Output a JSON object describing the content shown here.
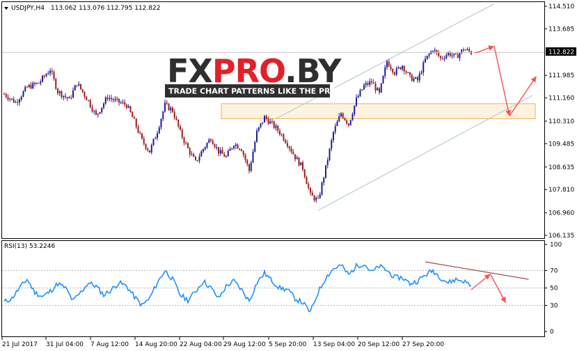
{
  "header": {
    "symbol": "USDJPY,H4",
    "ohlc": "113.062 113.076 112.795 112.822",
    "rsi_label": "RSI(13) 53.2246"
  },
  "logo": {
    "text": "FXPRO.BY",
    "tagline": "TRADE CHART PATTERNS LIKE THE PROS"
  },
  "price_axis": {
    "ticks": [
      "114.510",
      "113.685",
      "112.822",
      "111.985",
      "111.160",
      "110.310",
      "109.485",
      "108.635",
      "107.810",
      "106.960",
      "106.135"
    ],
    "current_price": "112.822"
  },
  "rsi_axis": {
    "ticks": [
      "100",
      "70",
      "50",
      "30",
      "0"
    ]
  },
  "time_axis": {
    "ticks": [
      "21 Jul 2017",
      "31 Jul 04:00",
      "7 Aug 12:00",
      "14 Aug 20:00",
      "22 Aug 04:00",
      "29 Aug 12:00",
      "5 Sep 20:00",
      "13 Sep 04:00",
      "20 Sep 12:00",
      "27 Sep 20:00"
    ]
  },
  "colors": {
    "bull_candle": "#1a1aa0",
    "bear_candle": "#9b1a1a",
    "rsi_line": "#1e90ff",
    "channel": "#a9c2d4",
    "zone_fill": "#fde9c6",
    "zone_border": "#f1b24a",
    "forecast_arrow": "#ff4d4d",
    "rsi_trend": "#a05050",
    "logo_red": "#e3202a",
    "logo_dark": "#2f2f2f"
  },
  "chart_data": [
    {
      "type": "candlestick",
      "title": "USDJPY,H4",
      "ylim": [
        106.135,
        114.51
      ],
      "x_ticks": [
        "21 Jul 2017",
        "31 Jul 04:00",
        "7 Aug 12:00",
        "14 Aug 20:00",
        "22 Aug 04:00",
        "29 Aug 12:00",
        "5 Sep 20:00",
        "13 Sep 04:00",
        "20 Sep 12:00",
        "27 Sep 20:00"
      ],
      "close_path": [
        [
          0,
          111.3
        ],
        [
          3,
          111.0
        ],
        [
          6,
          111.55
        ],
        [
          9,
          111.7
        ],
        [
          12,
          112.2
        ],
        [
          14,
          111.4
        ],
        [
          17,
          111.1
        ],
        [
          19,
          111.7
        ],
        [
          22,
          111.05
        ],
        [
          24,
          110.5
        ],
        [
          27,
          111.2
        ],
        [
          29,
          111.05
        ],
        [
          32,
          110.9
        ],
        [
          34,
          110.3
        ],
        [
          36,
          109.6
        ],
        [
          38,
          109.2
        ],
        [
          40,
          109.95
        ],
        [
          42,
          110.9
        ],
        [
          44,
          110.7
        ],
        [
          46,
          109.9
        ],
        [
          48,
          109.3
        ],
        [
          50,
          108.8
        ],
        [
          52,
          109.3
        ],
        [
          54,
          109.7
        ],
        [
          56,
          109.2
        ],
        [
          58,
          109.0
        ],
        [
          60,
          109.5
        ],
        [
          62,
          109.3
        ],
        [
          64,
          108.5
        ],
        [
          66,
          109.9
        ],
        [
          68,
          110.45
        ],
        [
          70,
          110.2
        ],
        [
          72,
          109.9
        ],
        [
          74,
          109.5
        ],
        [
          76,
          109.0
        ],
        [
          78,
          108.6
        ],
        [
          80,
          107.6
        ],
        [
          82,
          107.4
        ],
        [
          84,
          108.6
        ],
        [
          86,
          109.9
        ],
        [
          88,
          110.6
        ],
        [
          90,
          110.2
        ],
        [
          92,
          111.1
        ],
        [
          94,
          111.6
        ],
        [
          96,
          111.75
        ],
        [
          98,
          111.3
        ],
        [
          100,
          112.5
        ],
        [
          102,
          112.1
        ],
        [
          104,
          112.35
        ],
        [
          106,
          111.9
        ],
        [
          108,
          111.8
        ],
        [
          110,
          112.55
        ],
        [
          112,
          112.95
        ],
        [
          114,
          112.6
        ],
        [
          116,
          112.8
        ],
        [
          118,
          112.65
        ],
        [
          120,
          112.95
        ],
        [
          122,
          112.82
        ]
      ],
      "channel_lines": [
        {
          "from": [
            71,
            110.4
          ],
          "to": [
            128,
            114.6
          ]
        },
        {
          "from": [
            82,
            107.05
          ],
          "to": [
            138,
            111.25
          ]
        }
      ],
      "support_zone": [
        110.4,
        110.95
      ],
      "forecast_path": [
        [
          123,
          112.8
        ],
        [
          128,
          113.05
        ],
        [
          132,
          110.5
        ],
        [
          139,
          111.95
        ]
      ]
    },
    {
      "type": "line",
      "title": "RSI(13) 53.2246",
      "ylim": [
        0,
        100
      ],
      "levels": [
        30,
        50,
        70
      ],
      "series": [
        {
          "name": "RSI(13)",
          "x": [
            0,
            2,
            4,
            6,
            8,
            10,
            12,
            14,
            16,
            18,
            20,
            22,
            24,
            26,
            28,
            30,
            32,
            34,
            36,
            38,
            40,
            42,
            44,
            46,
            48,
            50,
            52,
            54,
            56,
            58,
            60,
            62,
            64,
            66,
            68,
            70,
            72,
            74,
            76,
            78,
            80,
            82,
            84,
            86,
            88,
            90,
            92,
            94,
            96,
            98,
            100,
            102,
            104,
            106,
            108,
            110,
            112,
            114,
            116,
            118,
            120,
            122
          ],
          "values": [
            34,
            38,
            50,
            60,
            45,
            40,
            46,
            55,
            50,
            35,
            45,
            56,
            52,
            42,
            48,
            56,
            52,
            40,
            30,
            38,
            56,
            70,
            60,
            42,
            36,
            46,
            58,
            50,
            38,
            52,
            58,
            48,
            35,
            56,
            67,
            58,
            50,
            48,
            38,
            33,
            22,
            45,
            62,
            72,
            76,
            65,
            75,
            78,
            68,
            75,
            70,
            62,
            62,
            55,
            58,
            65,
            70,
            62,
            56,
            60,
            58,
            53
          ]
        }
      ],
      "trend_line": {
        "from": [
          110,
          80
        ],
        "to": [
          137,
          60
        ]
      },
      "forecast_path": [
        [
          122,
          48
        ],
        [
          127,
          66
        ],
        [
          131,
          33
        ]
      ]
    }
  ]
}
